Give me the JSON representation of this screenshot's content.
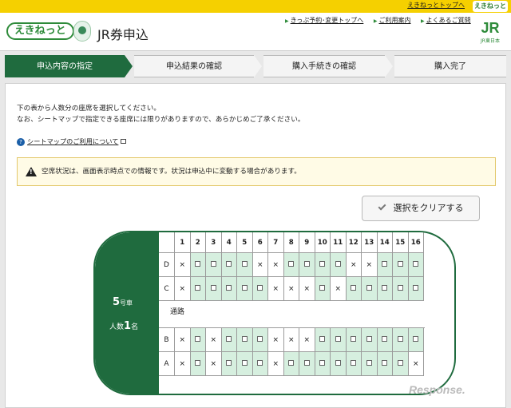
{
  "topbar": {
    "link": "えきねっとトップへ",
    "mini_logo": "えきねっと"
  },
  "header": {
    "logo": "えきねっと",
    "title": "JR券申込",
    "links": [
      "きっぷ予約･変更トップへ",
      "ご利用案内",
      "よくあるご質問"
    ],
    "jr_logo": "JR",
    "jr_sub": "JR東日本"
  },
  "steps": [
    "申込内容の指定",
    "申込結果の確認",
    "購入手続きの確認",
    "購入完了"
  ],
  "instructions": {
    "line1": "下の表から人数分の座席を選択してください。",
    "line2": "なお、シートマップで指定できる座席には限りがありますので、あらかじめご了承ください。"
  },
  "help_link": "シートマップのご利用について",
  "notice": "空席状況は、画面表示時点での情報です。状況は申込中に変動する場合があります。",
  "clear_button": "選択をクリアする",
  "car": {
    "number": "5",
    "number_suffix": "号車",
    "persons_label": "人数",
    "persons": "1",
    "persons_suffix": "名"
  },
  "seat_map": {
    "columns": [
      "1",
      "2",
      "3",
      "4",
      "5",
      "6",
      "7",
      "8",
      "9",
      "10",
      "11",
      "12",
      "13",
      "14",
      "15",
      "16"
    ],
    "aisle_label": "通路",
    "rows": [
      {
        "label": "D",
        "seats": "xooooxxooooxxoooo"
      },
      {
        "label": "C",
        "seats": "xoooooxxxoxoooooo"
      },
      {
        "label": "B",
        "seats": "xoxoooxxxooooooo"
      },
      {
        "label": "A",
        "seats": "xoxoooxoooooooox"
      }
    ]
  },
  "watermark": "Response."
}
